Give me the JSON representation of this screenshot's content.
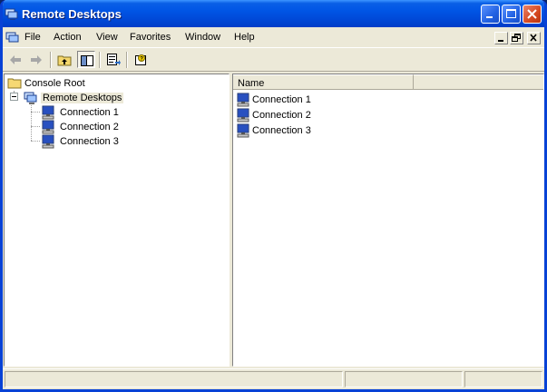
{
  "window": {
    "title": "Remote Desktops"
  },
  "menubar": {
    "items": [
      "File",
      "Action",
      "View",
      "Favorites",
      "Window",
      "Help"
    ]
  },
  "toolbar": {
    "buttons": [
      "back-icon",
      "forward-icon",
      "up-one-level-icon",
      "show-hide-tree-icon",
      "export-list-icon",
      "help-icon"
    ]
  },
  "tree": {
    "root": "Console Root",
    "remote_desktops": "Remote Desktops",
    "connections": [
      "Connection 1",
      "Connection 2",
      "Connection 3"
    ]
  },
  "list": {
    "columns": [
      "Name"
    ],
    "items": [
      "Connection 1",
      "Connection 2",
      "Connection 3"
    ]
  },
  "colors": {
    "titlebar": "#0055e5",
    "window_bg": "#ece9d8",
    "close_button": "#d5481f"
  }
}
